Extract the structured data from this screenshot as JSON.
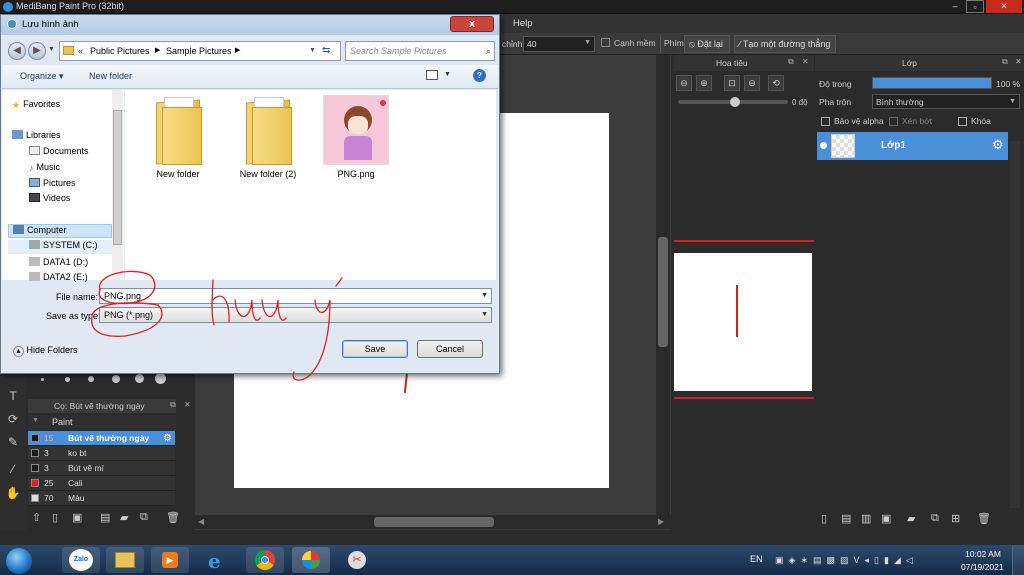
{
  "app": {
    "title": "MediBang Paint Pro (32bit)",
    "menu_help": "Help",
    "toolbar": {
      "partial_label": "chỉnh",
      "size_value": "40",
      "antialias_label": "Cạnh mềm",
      "shortcut_label": "Phím",
      "reset_label": "Đặt lại",
      "straight_line_label": "Tạo một đường thẳng"
    }
  },
  "navigator": {
    "title": "Hoa tiêu",
    "angle": "0 độ"
  },
  "layers": {
    "title": "Lớp",
    "opacity_label": "Độ trong",
    "opacity_value": "100 %",
    "opacity_fraction": 1.0,
    "blend_label": "Pha trộn",
    "blend_value": "Bình thường",
    "protect_alpha": "Bảo vệ alpha",
    "clipping": "Xén bớt",
    "lock": "Khóa",
    "layer_name": "Lớp1"
  },
  "brush_panel": {
    "title": "Cọ: Bút vẽ thường ngày",
    "group": "Paint",
    "items": [
      {
        "size": "15",
        "name": "Bút vẽ thường ngày",
        "color": "#1a1a1a",
        "selected": true
      },
      {
        "size": "3",
        "name": "ko bt",
        "color": "#1a1a1a",
        "selected": false
      },
      {
        "size": "3",
        "name": "Bút vẽ mí",
        "color": "#1a1a1a",
        "selected": false
      },
      {
        "size": "25",
        "name": "Cali",
        "color": "#e02020",
        "selected": false
      },
      {
        "size": "70",
        "name": "Màu",
        "color": "#dddddd",
        "selected": false
      }
    ]
  },
  "dialog": {
    "title": "Lưu hình ảnh",
    "close": "x",
    "breadcrumb": [
      "Public Pictures",
      "Sample Pictures"
    ],
    "search_placeholder": "Search Sample Pictures",
    "organize": "Organize",
    "new_folder": "New folder",
    "nav": {
      "favorites": "Favorites",
      "libraries": "Libraries",
      "documents": "Documents",
      "music": "Music",
      "pictures": "Pictures",
      "videos": "Videos",
      "computer": "Computer",
      "system": "SYSTEM (C:)",
      "data1": "DATA1 (D:)",
      "data2": "DATA2 (E:)"
    },
    "files": [
      {
        "name": "New folder",
        "kind": "folder"
      },
      {
        "name": "New folder (2)",
        "kind": "folder"
      },
      {
        "name": "PNG.png",
        "kind": "image"
      }
    ],
    "file_name_label": "File name:",
    "file_name_value": "PNG.png",
    "save_type_label": "Save as type:",
    "save_type_value": "PNG (*.png)",
    "hide_folders": "Hide Folders",
    "save": "Save",
    "cancel": "Cancel"
  },
  "taskbar": {
    "lang": "EN",
    "time": "10:02 AM",
    "date": "07/19/2021",
    "zalo": "Zalo"
  },
  "colors": {
    "accent_blue": "#4a90d9",
    "annotation_red": "#e02020",
    "layer_selected": "#4a90d9"
  }
}
